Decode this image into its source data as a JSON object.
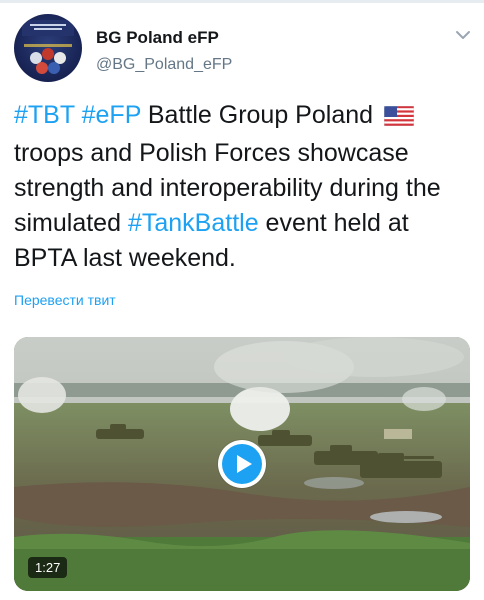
{
  "colors": {
    "accent": "#1da1f2",
    "text": "#14171a",
    "secondary": "#657786"
  },
  "author": {
    "display_name": "BG Poland eFP",
    "handle": "@BG_Poland_eFP",
    "avatar_icon": "battle-group-poland-logo"
  },
  "tweet": {
    "segments": [
      {
        "text": "#TBT",
        "type": "hashtag"
      },
      {
        "text": " ",
        "type": "text"
      },
      {
        "text": "#eFP",
        "type": "hashtag"
      },
      {
        "text": " Battle Group Poland ",
        "type": "text"
      },
      {
        "text": "🇺🇸",
        "type": "emoji",
        "icon": "us-flag-icon"
      },
      {
        "text": " troops and Polish Forces showcase strength and interoperability during the simulated ",
        "type": "text"
      },
      {
        "text": "#TankBattle",
        "type": "hashtag"
      },
      {
        "text": " event held at BPTA last weekend.",
        "type": "text"
      }
    ]
  },
  "translate_label": "Перевести твит",
  "media": {
    "duration": "1:27",
    "play_icon": "play-icon",
    "menu_icon": "chevron-down-icon"
  }
}
